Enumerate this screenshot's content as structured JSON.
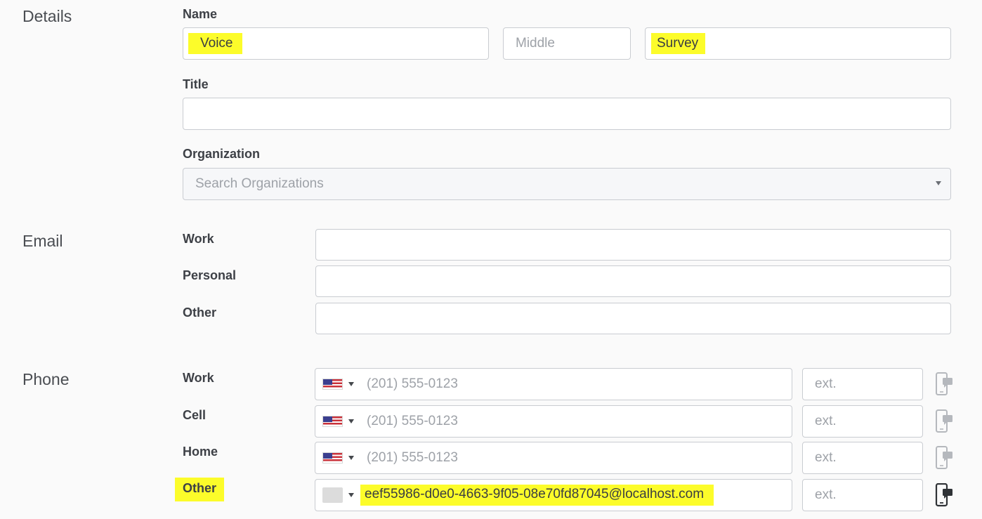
{
  "details": {
    "section_title": "Details",
    "name_label": "Name",
    "first_name": "Voice",
    "middle_placeholder": "Middle",
    "last_name": "Survey",
    "title_label": "Title",
    "title_value": "",
    "organization_label": "Organization",
    "organization_placeholder": "Search Organizations"
  },
  "email": {
    "section_title": "Email",
    "rows": [
      {
        "label": "Work",
        "value": ""
      },
      {
        "label": "Personal",
        "value": ""
      },
      {
        "label": "Other",
        "value": ""
      }
    ]
  },
  "phone": {
    "section_title": "Phone",
    "ext_placeholder": "ext.",
    "rows": [
      {
        "label": "Work",
        "placeholder": "(201) 555-0123",
        "value": ""
      },
      {
        "label": "Cell",
        "placeholder": "(201) 555-0123",
        "value": ""
      },
      {
        "label": "Home",
        "placeholder": "(201) 555-0123",
        "value": ""
      },
      {
        "label": "Other",
        "placeholder": "",
        "value": "eef55986-d0e0-4663-9f05-08e70fd87045@localhost.com"
      }
    ]
  },
  "colors": {
    "highlight": "#fcfc2a",
    "border": "#c9ccd1",
    "placeholder": "#9ea2a8",
    "icon_inactive": "#b5b8bd",
    "icon_active": "#2f3236"
  }
}
